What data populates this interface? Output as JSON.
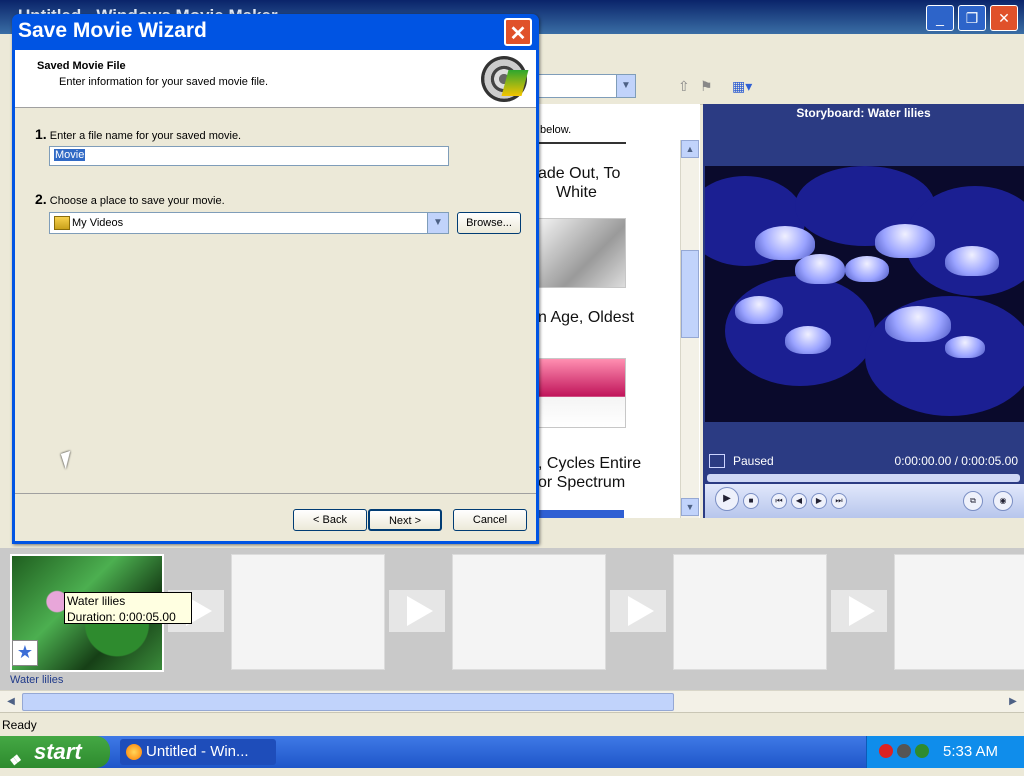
{
  "app": {
    "title": "Untitled - Windows Movie Maker"
  },
  "collections": {
    "hint": "below.",
    "transitions": [
      "Fade Out, To White",
      "Film Age, Oldest",
      "Flash, Cycles Entire Color Spectrum"
    ],
    "visible_labels": [
      "ade Out, To",
      "White",
      "n Age, Oldest",
      ", Cycles Entire",
      "or Spectrum"
    ]
  },
  "monitor": {
    "title": "Storyboard: Water lilies",
    "status": "Paused",
    "time": "0:00:00.00 / 0:00:05.00"
  },
  "storyboard": {
    "clip": {
      "name": "Water lilies",
      "duration": "Duration:  0:00:05.00"
    }
  },
  "statusbar": {
    "text": "Ready"
  },
  "taskbar": {
    "start": "start",
    "task": "Untitled - Win...",
    "clock": "5:33 AM"
  },
  "dialog": {
    "title": "Save Movie Wizard",
    "header": "Saved Movie File",
    "subheader": "Enter information for your saved movie file.",
    "step1_num": "1.",
    "step1_label": "Enter a file name for your saved movie.",
    "filename": "Movie",
    "step2_num": "2.",
    "step2_label": "Choose a place to save your movie.",
    "location": "My Videos",
    "browse": "Browse...",
    "back": "< Back",
    "next": "Next >",
    "cancel": "Cancel"
  }
}
